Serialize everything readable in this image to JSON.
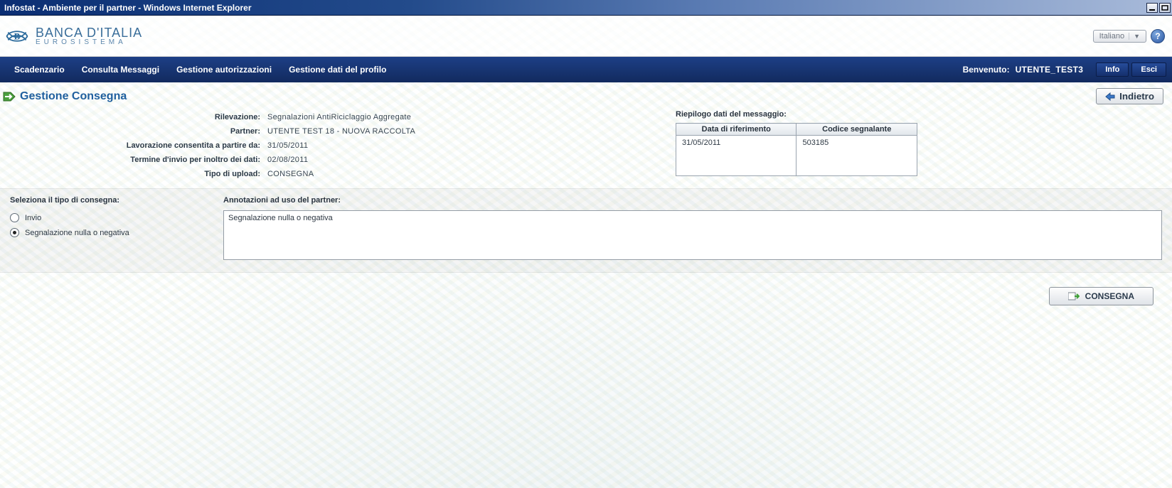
{
  "window": {
    "title": "Infostat - Ambiente per il partner - Windows Internet Explorer"
  },
  "header": {
    "brand_line1": "BANCA D'ITALIA",
    "brand_line2": "EUROSISTEMA",
    "language_selected": "Italiano"
  },
  "menubar": {
    "items": [
      "Scadenzario",
      "Consulta Messaggi",
      "Gestione autorizzazioni",
      "Gestione dati del profilo"
    ],
    "welcome_label": "Benvenuto:",
    "username": "UTENTE_TEST3",
    "info_btn": "Info",
    "exit_btn": "Esci"
  },
  "page": {
    "title": "Gestione Consegna",
    "back_btn": "Indietro"
  },
  "meta": {
    "rows": [
      {
        "label": "Rilevazione:",
        "value": "Segnalazioni AntiRiciclaggio Aggregate"
      },
      {
        "label": "Partner:",
        "value": "UTENTE TEST 18 - NUOVA RACCOLTA"
      },
      {
        "label": "Lavorazione consentita a partire da:",
        "value": "31/05/2011"
      },
      {
        "label": "Termine d'invio per inoltro dei dati:",
        "value": "02/08/2011"
      },
      {
        "label": "Tipo di upload:",
        "value": "CONSEGNA"
      }
    ]
  },
  "summary": {
    "title": "Riepilogo dati del messaggio:",
    "columns": [
      "Data di riferimento",
      "Codice segnalante"
    ],
    "rows": [
      {
        "data_riferimento": "31/05/2011",
        "codice_segnalante": "503185"
      }
    ]
  },
  "form": {
    "select_type_label": "Seleziona il tipo di consegna:",
    "options": [
      {
        "label": "Invio",
        "checked": false
      },
      {
        "label": "Segnalazione nulla o negativa",
        "checked": true
      }
    ],
    "notes_label": "Annotazioni ad uso del partner:",
    "notes_value": "Segnalazione nulla o negativa"
  },
  "actions": {
    "consegna_btn": "CONSEGNA"
  }
}
